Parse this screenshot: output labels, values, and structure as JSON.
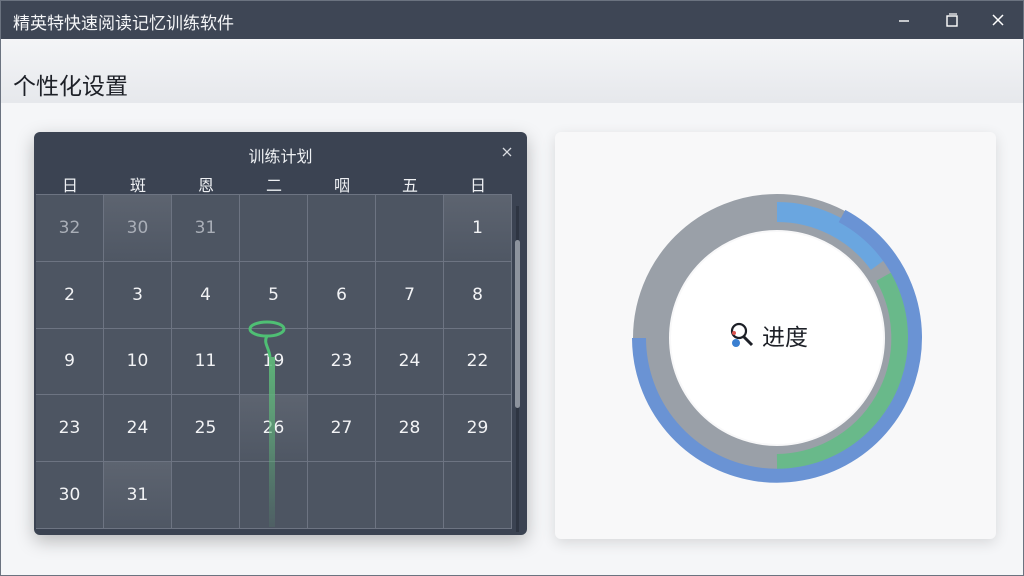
{
  "window": {
    "title": "精英特快速阅读记忆训练软件",
    "controls": [
      "minimize-icon",
      "maximize-icon",
      "close-icon"
    ]
  },
  "page": {
    "title": "个性化设置"
  },
  "calendar": {
    "title": "训练计划",
    "weekdays": [
      "日",
      "斑",
      "恩",
      "二",
      "咽",
      "五",
      "日"
    ],
    "rows": [
      [
        "32",
        "30",
        "31",
        "",
        "",
        "",
        "1"
      ],
      [
        "2",
        "3",
        "4",
        "5",
        "6",
        "7",
        "8"
      ],
      [
        "9",
        "10",
        "11",
        "19",
        "23",
        "24",
        "22"
      ],
      [
        "23",
        "24",
        "25",
        "26",
        "27",
        "28",
        "29"
      ],
      [
        "30",
        "31",
        "",
        "",
        "",
        "",
        ""
      ]
    ]
  },
  "progress": {
    "label": "进度",
    "icon": "search-person-icon",
    "colors": {
      "gray": "#9aa0a8",
      "blue": "#6a93d4",
      "lightblue": "#6aa6e0",
      "green": "#69b98a"
    }
  }
}
